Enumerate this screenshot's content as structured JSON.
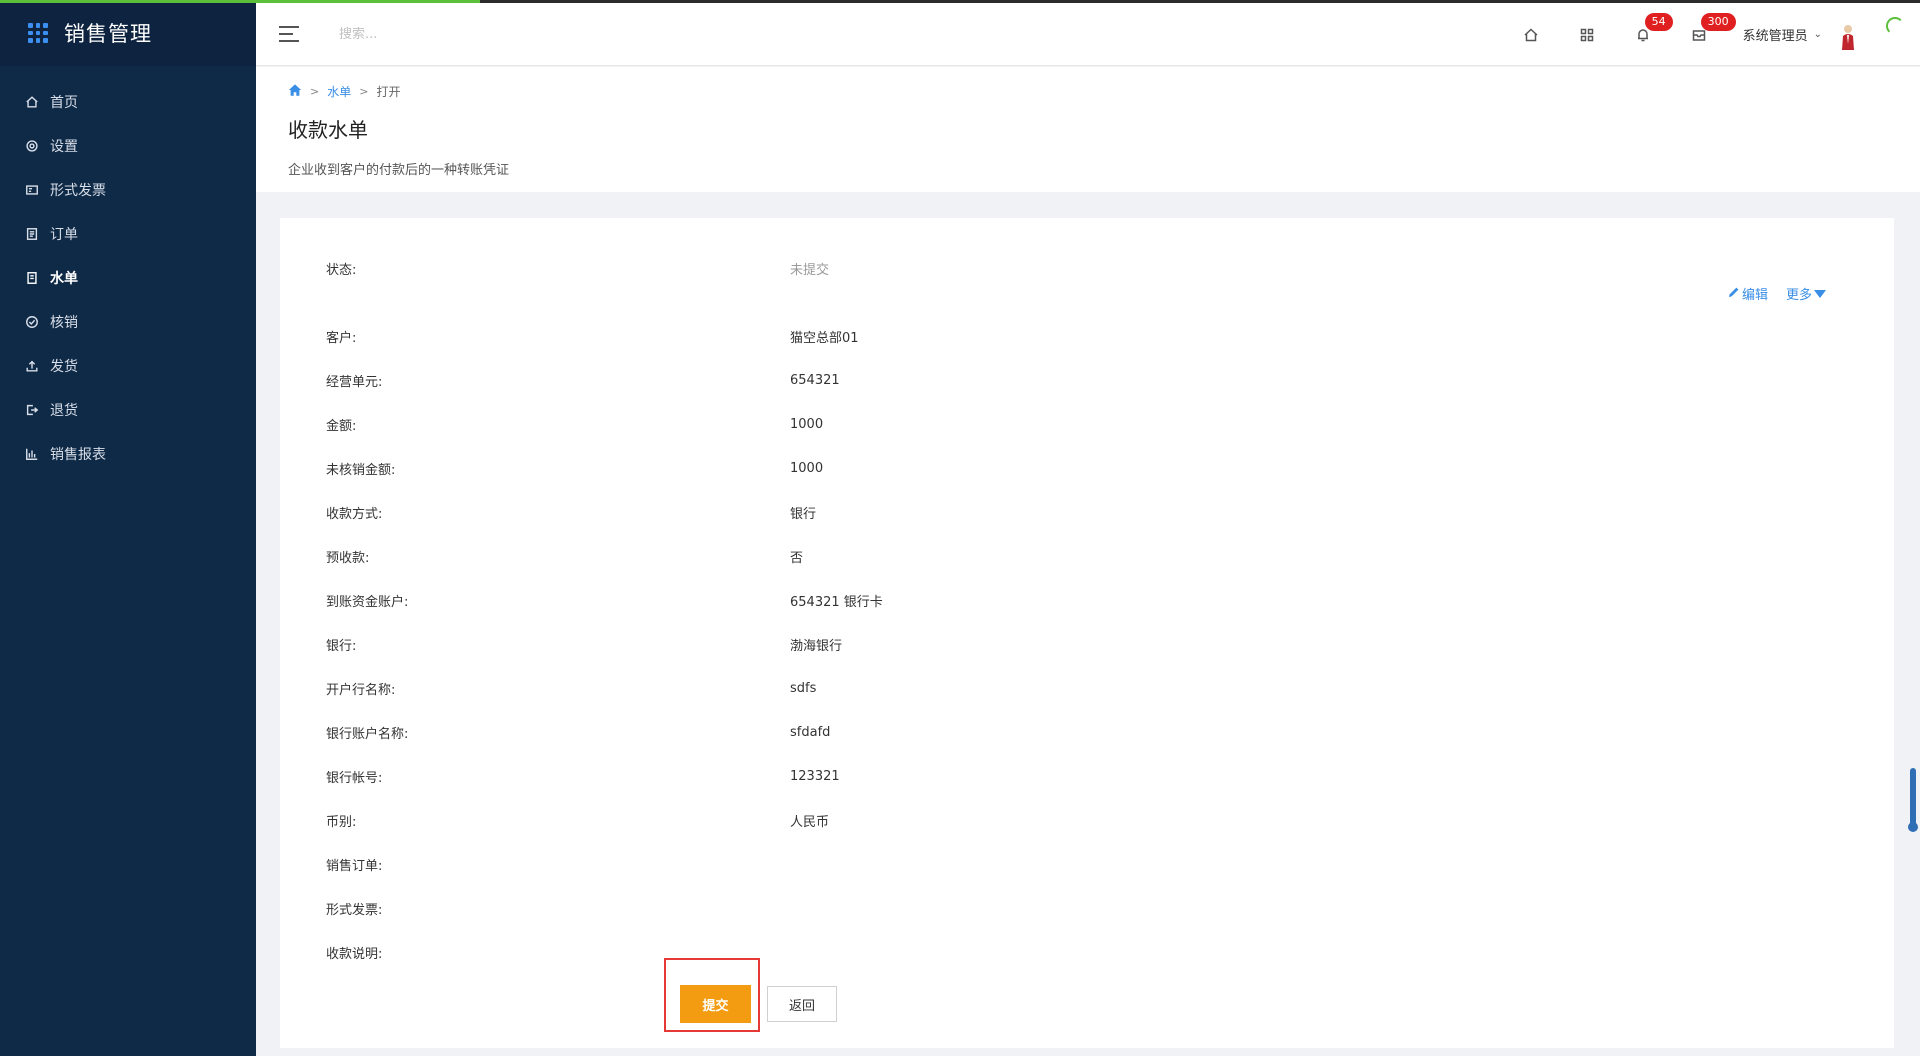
{
  "app": {
    "title": "销售管理"
  },
  "sidebar": {
    "items": [
      {
        "label": "首页",
        "icon": "home-icon"
      },
      {
        "label": "设置",
        "icon": "gear-icon"
      },
      {
        "label": "形式发票",
        "icon": "invoice-icon"
      },
      {
        "label": "订单",
        "icon": "order-icon"
      },
      {
        "label": "水单",
        "icon": "receipt-icon",
        "active": true
      },
      {
        "label": "核销",
        "icon": "check-circle-icon"
      },
      {
        "label": "发货",
        "icon": "upload-icon"
      },
      {
        "label": "退货",
        "icon": "return-icon"
      },
      {
        "label": "销售报表",
        "icon": "bar-chart-icon"
      }
    ]
  },
  "header": {
    "search_placeholder": "搜索...",
    "notification_count": "54",
    "message_count": "300",
    "user_name": "系统管理员"
  },
  "breadcrumb": {
    "parent": "水单",
    "current": "打开"
  },
  "page": {
    "title": "收款水单",
    "description": "企业收到客户的付款后的一种转账凭证"
  },
  "actions": {
    "edit_label": "编辑",
    "more_label": "更多"
  },
  "fields": [
    {
      "label": "状态:",
      "value": "未提交"
    },
    {
      "label": "客户:",
      "value": "猫空总部01"
    },
    {
      "label": "经营单元:",
      "value": "654321"
    },
    {
      "label": "金额:",
      "value": "1000"
    },
    {
      "label": "未核销金额:",
      "value": "1000"
    },
    {
      "label": "收款方式:",
      "value": "银行"
    },
    {
      "label": "预收款:",
      "value": "否"
    },
    {
      "label": "到账资金账户:",
      "value": "654321 银行卡"
    },
    {
      "label": "银行:",
      "value": "渤海银行"
    },
    {
      "label": "开户行名称:",
      "value": "sdfs"
    },
    {
      "label": "银行账户名称:",
      "value": "sfdafd"
    },
    {
      "label": "银行帐号:",
      "value": "123321"
    },
    {
      "label": "币别:",
      "value": "人民币"
    },
    {
      "label": "销售订单:",
      "value": ""
    },
    {
      "label": "形式发票:",
      "value": ""
    },
    {
      "label": "收款说明:",
      "value": ""
    }
  ],
  "buttons": {
    "submit_label": "提交",
    "back_label": "返回"
  },
  "colors": {
    "sidebar_bg": "#0f2a47",
    "accent": "#3a8ee6",
    "submit": "#f39c12",
    "badge": "#e02020",
    "highlight": "#e53935"
  },
  "load_progress": 0.25
}
